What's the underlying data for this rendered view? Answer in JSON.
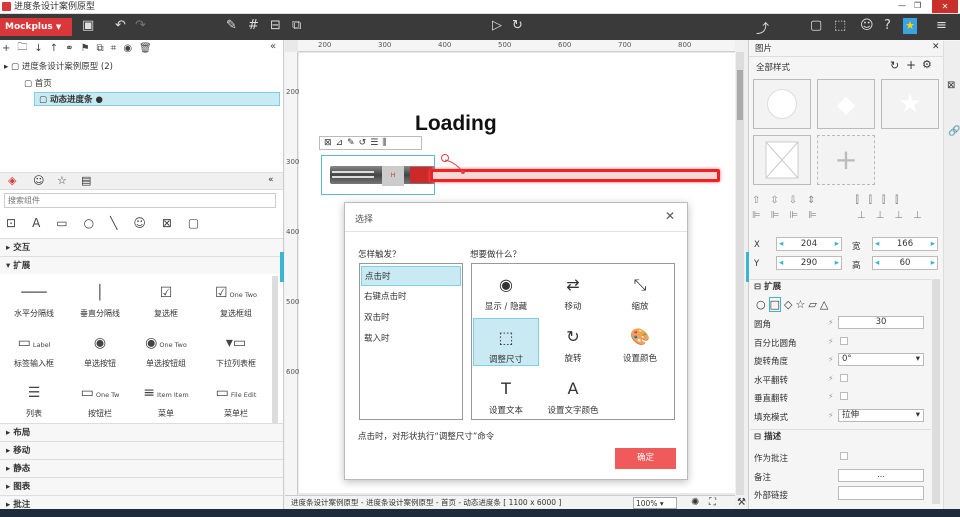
{
  "window": {
    "title": "进度条设计案例原型"
  },
  "toolbar": {
    "brand": "Mockplus"
  },
  "tree": {
    "project": "进度条设计案例原型 (2)",
    "items": [
      "首页",
      "动态进度条"
    ]
  },
  "search": {
    "placeholder": "搜索组件"
  },
  "sections": [
    "交互",
    "扩展",
    "布局",
    "移动",
    "静态",
    "图表",
    "批注"
  ],
  "components": [
    {
      "label": "水平分隔线",
      "icon": "hline-icon"
    },
    {
      "label": "垂直分隔线",
      "icon": "vline-icon"
    },
    {
      "label": "复选框",
      "icon": "checkbox-icon"
    },
    {
      "label": "复选框组",
      "icon": "checkbox-group-icon",
      "sub": [
        "One",
        "Two"
      ]
    },
    {
      "label": "标签输入框",
      "icon": "label-input-icon",
      "sub": [
        "Label"
      ]
    },
    {
      "label": "单选按钮",
      "icon": "radio-icon"
    },
    {
      "label": "单选按钮组",
      "icon": "radio-group-icon",
      "sub": [
        "One",
        "Two"
      ]
    },
    {
      "label": "下拉列表框",
      "icon": "dropdown-icon"
    },
    {
      "label": "列表",
      "icon": "list-icon"
    },
    {
      "label": "按钮栏",
      "icon": "button-bar-icon",
      "sub": [
        "One",
        "Tw"
      ]
    },
    {
      "label": "菜单",
      "icon": "menu-icon",
      "sub": [
        "Item",
        "Item"
      ]
    },
    {
      "label": "菜单栏",
      "icon": "menubar-icon",
      "sub": [
        "File",
        "Edit"
      ]
    }
  ],
  "ruler": {
    "h": [
      "200",
      "300",
      "400",
      "500",
      "600",
      "700",
      "800"
    ],
    "v": [
      "200",
      "300",
      "400",
      "500",
      "600"
    ]
  },
  "canvas": {
    "heading": "Loading"
  },
  "dialog": {
    "title": "选择",
    "trigger_label": "怎样触发？",
    "action_label": "想要做什么？",
    "triggers": [
      "点击时",
      "右键点击时",
      "双击时",
      "载入时"
    ],
    "actions": [
      {
        "label": "显示 / 隐藏",
        "icon": "eye-icon",
        "glyph": "◉"
      },
      {
        "label": "移动",
        "icon": "move-icon",
        "glyph": "⇄"
      },
      {
        "label": "缩放",
        "icon": "scale-icon",
        "glyph": "⤡"
      },
      {
        "label": "调整尺寸",
        "icon": "resize-icon",
        "glyph": "⬚"
      },
      {
        "label": "旋转",
        "icon": "rotate-icon",
        "glyph": "↻"
      },
      {
        "label": "设置颜色",
        "icon": "palette-icon",
        "glyph": "🎨"
      },
      {
        "label": "设置文本",
        "icon": "text-icon",
        "glyph": "T"
      },
      {
        "label": "设置文字颜色",
        "icon": "text-color-icon",
        "glyph": "A"
      }
    ],
    "hint": "点击时，对形状执行“调整尺寸”命令",
    "confirm": "确定"
  },
  "status": {
    "path": "进度条设计案例原型 - 进度条设计案例原型 - 首页 - 动态进度条 [ 1100 x 6000 ]",
    "zoom": "100%"
  },
  "right": {
    "header": "图片",
    "style": "全部样式",
    "x": "204",
    "y": "290",
    "w": "166",
    "h": "60",
    "x_label": "X",
    "y_label": "Y",
    "w_label": "宽",
    "h_label": "高",
    "ext": "扩展",
    "rows": [
      {
        "label": "圆角",
        "value": "30"
      },
      {
        "label": "百分比圆角",
        "value": ""
      },
      {
        "label": "旋转角度",
        "value": "0°"
      },
      {
        "label": "水平翻转",
        "value": ""
      },
      {
        "label": "垂直翻转",
        "value": ""
      },
      {
        "label": "填充模式",
        "value": "拉伸"
      }
    ],
    "desc": "描述",
    "annotate": "作为批注",
    "note": "备注",
    "note_value": "...",
    "link": "外部链接"
  },
  "colors": {
    "brand": "#d9373a",
    "selected": "#c9eaf2",
    "confirm": "#f05a5a",
    "accent": "#3cb5d0"
  }
}
